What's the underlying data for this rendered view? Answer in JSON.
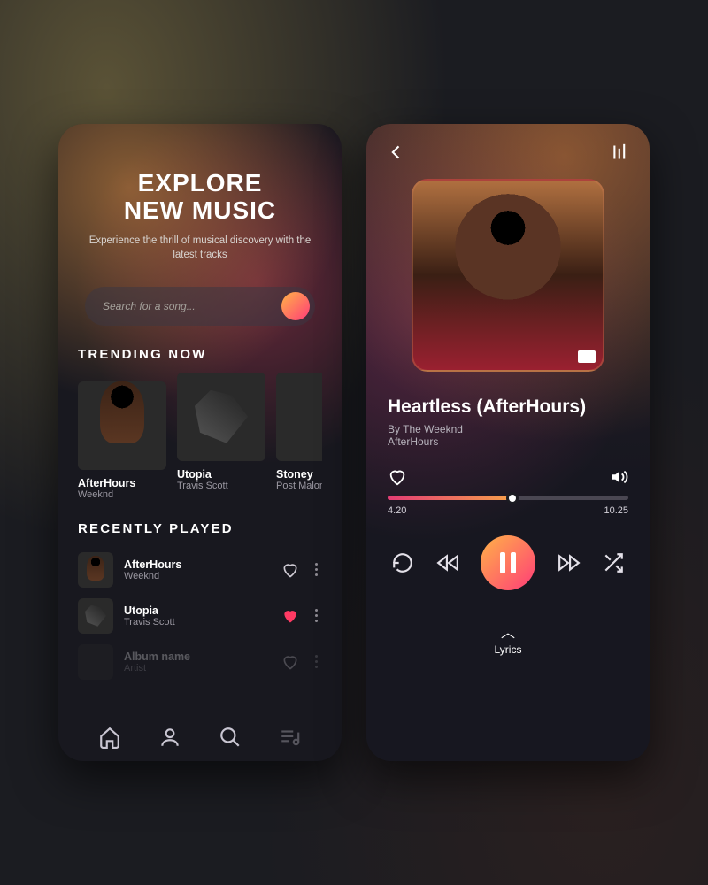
{
  "explore": {
    "heading_line1": "EXPLORE",
    "heading_line2": "NEW MUSIC",
    "subtitle": "Experience the thrill of musical discovery with the latest tracks",
    "search_placeholder": "Search for a song...",
    "trending_header": "TRENDING NOW",
    "trending": [
      {
        "title": "AfterHours",
        "artist": "Weeknd"
      },
      {
        "title": "Utopia",
        "artist": "Travis Scott"
      },
      {
        "title": "Stoney",
        "artist": "Post Malone"
      }
    ],
    "recently_header": "RECENTLY PLAYED",
    "recent": [
      {
        "title": "AfterHours",
        "artist": "Weeknd",
        "liked": false
      },
      {
        "title": "Utopia",
        "artist": "Travis Scott",
        "liked": true
      },
      {
        "title": "Album name",
        "artist": "Artist",
        "liked": false
      }
    ]
  },
  "player": {
    "track_title": "Heartless (AfterHours)",
    "by_line": "By The Weeknd",
    "album": "AfterHours",
    "elapsed": "4.20",
    "duration": "10.25",
    "progress_percent": 52,
    "lyrics_label": "Lyrics",
    "liked": false
  },
  "colors": {
    "accent_gradient_start": "#ffb347",
    "accent_gradient_end": "#ff3c78",
    "heart_active": "#ff3a63"
  }
}
